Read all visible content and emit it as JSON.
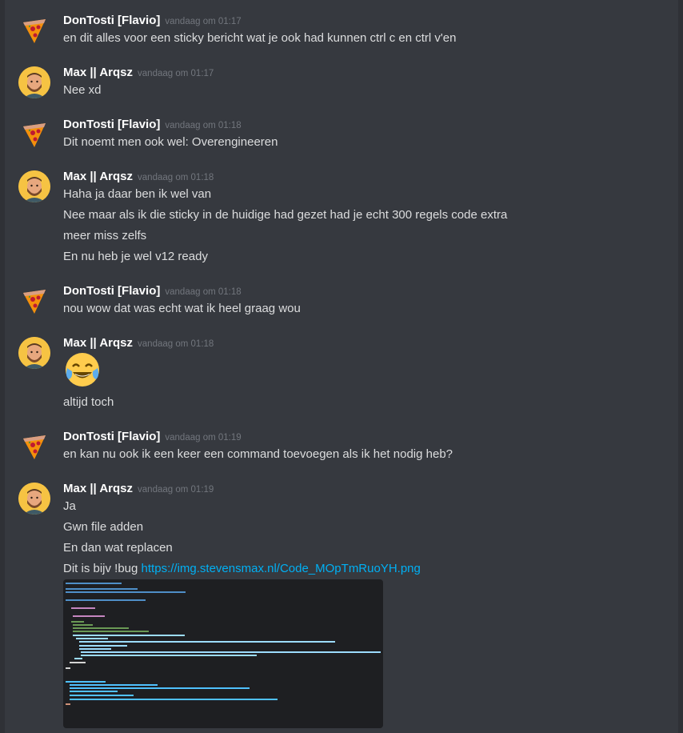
{
  "messages": [
    {
      "author": "DonTosti [Flavio]",
      "time": "vandaag om 01:17",
      "avatar": "pizza-icon",
      "lines": [
        "en dit alles voor een sticky bericht wat je ook had kunnen ctrl c en ctrl v'en"
      ]
    },
    {
      "author": "Max || Arqsz",
      "time": "vandaag om 01:17",
      "avatar": "max-avatar",
      "lines": [
        "Nee xd"
      ]
    },
    {
      "author": "DonTosti [Flavio]",
      "time": "vandaag om 01:18",
      "avatar": "pizza-icon",
      "lines": [
        "Dit noemt men ook wel: Overengineeren"
      ]
    },
    {
      "author": "Max || Arqsz",
      "time": "vandaag om 01:18",
      "avatar": "max-avatar",
      "lines": [
        "Haha ja daar ben ik wel van",
        "Nee maar als ik die sticky in de huidige had gezet had je echt 300 regels code extra",
        "meer miss zelfs",
        "En nu heb je wel v12 ready"
      ]
    },
    {
      "author": "DonTosti [Flavio]",
      "time": "vandaag om 01:18",
      "avatar": "pizza-icon",
      "lines": [
        "nou wow dat was echt wat ik heel graag wou"
      ]
    },
    {
      "author": "Max || Arqsz",
      "time": "vandaag om 01:18",
      "avatar": "max-avatar",
      "emoji": "joy-emoji-icon",
      "lines": [
        "altijd toch"
      ]
    },
    {
      "author": "DonTosti [Flavio]",
      "time": "vandaag om 01:19",
      "avatar": "pizza-icon",
      "lines": [
        "en kan nu ook ik een keer een command toevoegen als ik het nodig heb?"
      ]
    },
    {
      "author": "Max || Arqsz",
      "time": "vandaag om 01:19",
      "avatar": "max-avatar",
      "lines": [
        "Ja",
        "Gwn file adden",
        "En dan wat replacen"
      ],
      "link_prefix": "Dit is bijv !bug ",
      "link_text": "https://img.stevensmax.nl/Code_MOpTmRuoYH.png",
      "attachment": "code-screenshot-image"
    }
  ],
  "colors": {
    "background": "#36393f",
    "author": "#ffffff",
    "text": "#dcddde",
    "timestamp": "#72767d",
    "link": "#00b0f4"
  }
}
